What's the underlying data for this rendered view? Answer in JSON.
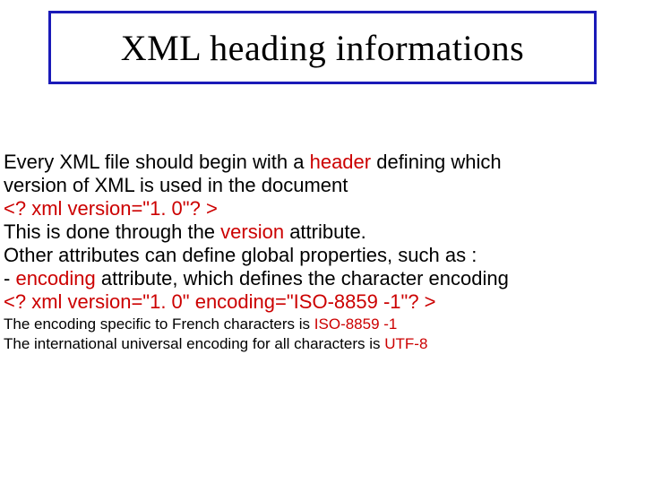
{
  "title": "XML heading informations",
  "body": {
    "line1a": "Every XML file should begin with a ",
    "line1b": "header",
    "line1c": " defining which",
    "line2": "version of XML is used in the document",
    "code1": "<? xml version=\"1. 0\"? >",
    "line3a": "This is done through the ",
    "line3b": "version",
    "line3c": " attribute.",
    "line4": "Other attributes can define global properties, such as :",
    "line5a": " - ",
    "line5b": "encoding",
    "line5c": " attribute, which defines the character encoding",
    "code2": "<? xml version=\"1. 0\" encoding=\"ISO-8859 -1\"? >",
    "small1a": "The encoding specific to French characters is ",
    "small1b": "ISO-8859 -1",
    "small2a": "The international universal encoding for all characters is ",
    "small2b": "UTF-8"
  }
}
